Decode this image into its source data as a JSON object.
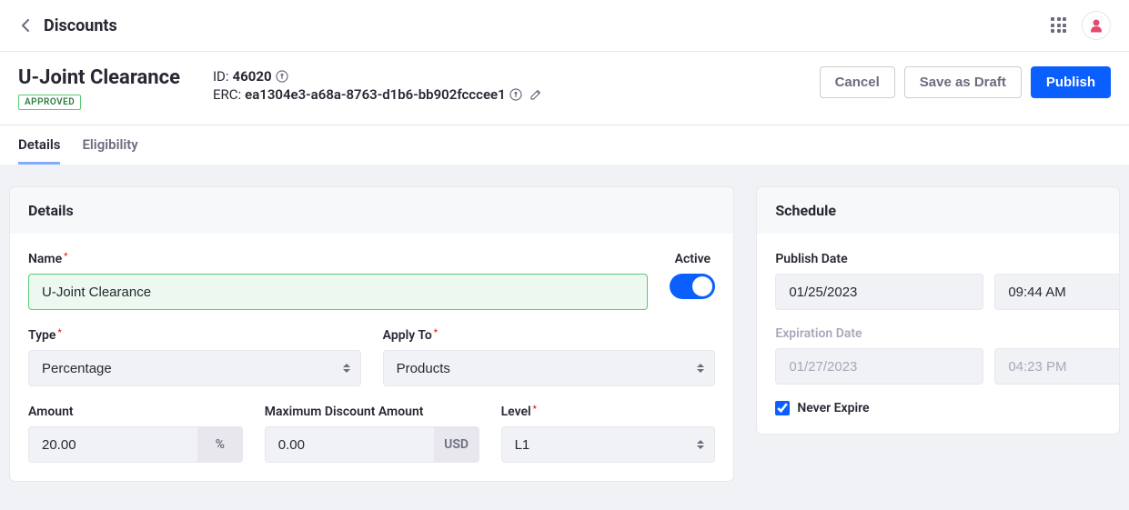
{
  "breadcrumb": {
    "title": "Discounts"
  },
  "header": {
    "title": "U-Joint Clearance",
    "status_label": "APPROVED",
    "id_label": "ID: ",
    "id_value": "46020",
    "erc_label": "ERC: ",
    "erc_value": "ea1304e3-a68a-8763-d1b6-bb902fcccee1",
    "buttons": {
      "cancel": "Cancel",
      "save_draft": "Save as Draft",
      "publish": "Publish"
    }
  },
  "tabs": {
    "details": "Details",
    "eligibility": "Eligibility"
  },
  "details_panel": {
    "heading": "Details",
    "name_label": "Name",
    "name_value": "U-Joint Clearance",
    "active_label": "Active",
    "type_label": "Type",
    "type_value": "Percentage",
    "apply_to_label": "Apply To",
    "apply_to_value": "Products",
    "amount_label": "Amount",
    "amount_value": "20.00",
    "amount_unit": "%",
    "max_discount_label": "Maximum Discount Amount",
    "max_discount_value": "0.00",
    "max_discount_unit": "USD",
    "level_label": "Level",
    "level_value": "L1"
  },
  "schedule_panel": {
    "heading": "Schedule",
    "publish_date_label": "Publish Date",
    "publish_date": "01/25/2023",
    "publish_time": "09:44 AM",
    "expiration_date_label": "Expiration Date",
    "expiration_date": "01/27/2023",
    "expiration_time": "04:23 PM",
    "never_expire_label": "Never Expire"
  }
}
